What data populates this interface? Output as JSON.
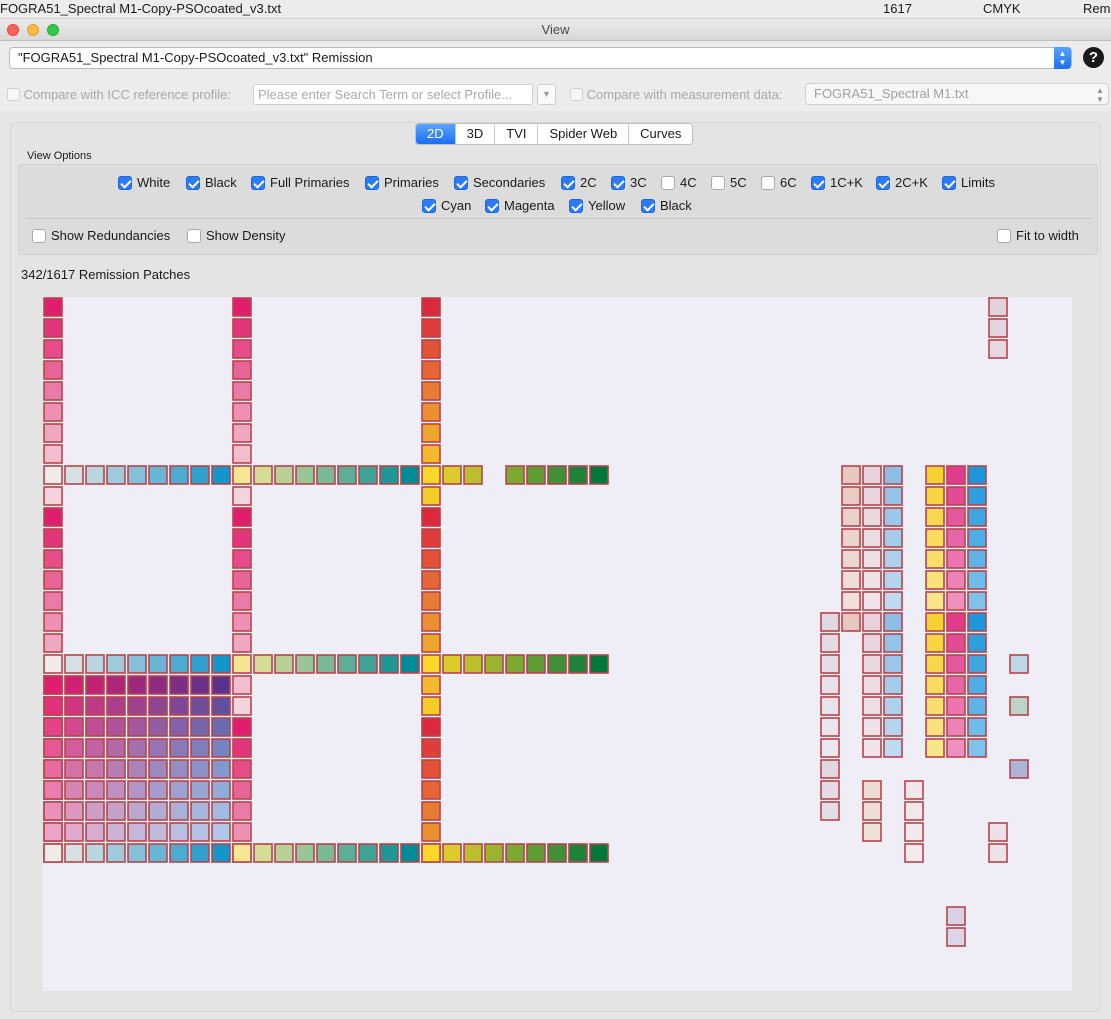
{
  "menubar": {
    "filename": "FOGRA51_Spectral M1-Copy-PSOcoated_v3.txt",
    "count": "1617",
    "mode": "CMYK",
    "cut_text": "Rem"
  },
  "window": {
    "title": "View"
  },
  "profile_select": {
    "value": "\"FOGRA51_Spectral M1-Copy-PSOcoated_v3.txt\" Remission"
  },
  "help_label": "?",
  "compare": {
    "icc_label": "Compare with ICC reference profile:",
    "search_placeholder": "Please enter Search Term or select Profile...",
    "measurement_label": "Compare with measurement data:",
    "measurement_value": "FOGRA51_Spectral M1.txt"
  },
  "tabs": [
    {
      "label": "2D",
      "active": true
    },
    {
      "label": "3D",
      "active": false
    },
    {
      "label": "TVI",
      "active": false
    },
    {
      "label": "Spider Web",
      "active": false
    },
    {
      "label": "Curves",
      "active": false
    }
  ],
  "view_options": {
    "title": "View Options",
    "row1": [
      {
        "label": "White",
        "checked": true
      },
      {
        "label": "Black",
        "checked": true
      },
      {
        "label": "Full Primaries",
        "checked": true
      },
      {
        "label": "Primaries",
        "checked": true
      },
      {
        "label": "Secondaries",
        "checked": true
      },
      {
        "label": "2C",
        "checked": true
      },
      {
        "label": "3C",
        "checked": true
      },
      {
        "label": "4C",
        "checked": false
      },
      {
        "label": "5C",
        "checked": false
      },
      {
        "label": "6C",
        "checked": false
      },
      {
        "label": "1C+K",
        "checked": true
      },
      {
        "label": "2C+K",
        "checked": true
      },
      {
        "label": "Limits",
        "checked": true
      }
    ],
    "row2": [
      {
        "label": "Cyan",
        "checked": true
      },
      {
        "label": "Magenta",
        "checked": true
      },
      {
        "label": "Yellow",
        "checked": true
      },
      {
        "label": "Black",
        "checked": true
      }
    ],
    "show_redundancies": {
      "label": "Show Redundancies",
      "checked": false
    },
    "show_density": {
      "label": "Show Density",
      "checked": false
    },
    "fit_to_width": {
      "label": "Fit to width",
      "checked": false
    }
  },
  "patch_count_text": "342/1617 Remission Patches",
  "colors": {
    "accent": "#1f6ef2",
    "cell_border": "#b5454b",
    "plot_bg": "#efeef7"
  }
}
